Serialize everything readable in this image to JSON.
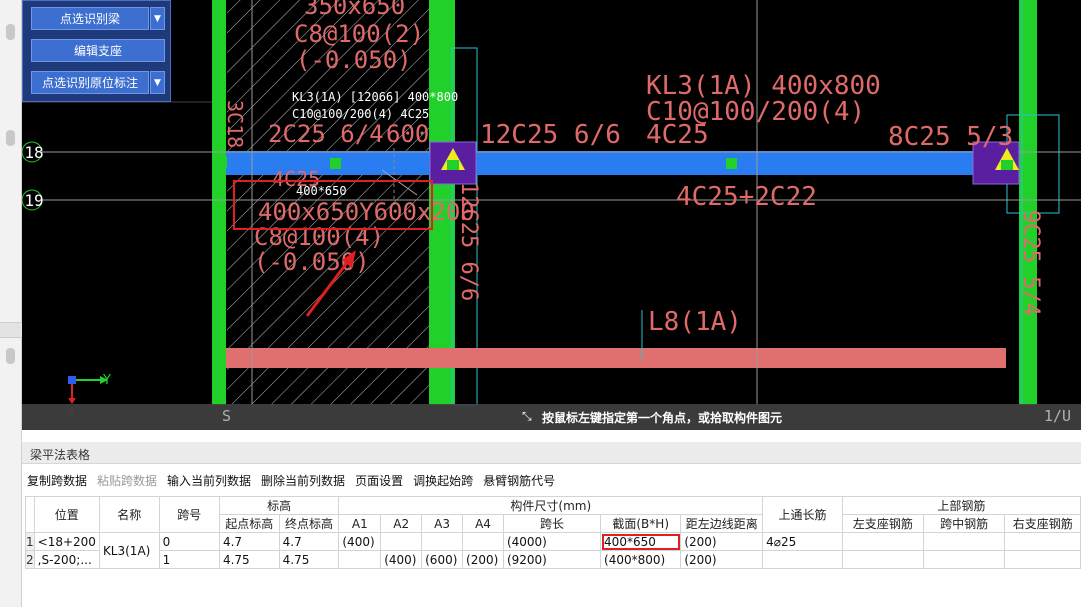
{
  "tool_panel": {
    "btn_identify_beam": "点选识别梁",
    "btn_edit_support": "编辑支座",
    "btn_identify_annotation": "点选识别原位标注"
  },
  "canvas": {
    "axis_labels": [
      "18",
      "19"
    ],
    "ucs_y": "Y",
    "ucs_x": "X",
    "texts": {
      "t_350x650": "350x650",
      "t_c8_100_2": "C8@100(2)",
      "t_m0050_top": "(-0.050)",
      "t_3c18": "3C18",
      "t_kl3_tip": "KL3(1A) [12066] 400*800",
      "t_c10_tip": "C10@100/200(4) 4C25",
      "t_2c25": "2C25 6/4",
      "t_600": "600",
      "t_12c25_66": "12C25 6/6",
      "t_kl3_big": "KL3(1A) 400x800",
      "t_c10_big": "C10@100/200(4)",
      "t_4c25": "4C25",
      "t_8c25": "8C25 5/3",
      "t_400x650_small": "400*650",
      "t_4c25_small": "4C25",
      "t_400x650_big": "400x650Y600x200",
      "t_c8_100_4": "C8@100(4)",
      "t_m0050_bot": "(-0.050)",
      "t_12c25_vert": "12C25 6/6",
      "t_4c25_2c22": "4C25+2C22",
      "t_9c25": "9C25 5/4",
      "t_l8": "L8(1A)"
    },
    "colors": {
      "column_green": "#22d02a",
      "beam_blue": "#2a7df0",
      "beam_red": "#e07070",
      "axis_gray": "#9a9a9a",
      "cad_text": "#e06a6a",
      "highlight_red": "#e02020"
    }
  },
  "status_bar": {
    "prompt": "按鼠标左键指定第一个角点，或拾取构件图元",
    "left_glyph": "S",
    "right_glyph": "1/U"
  },
  "panel": {
    "title": "梁平法表格",
    "toolbar": [
      {
        "label": "复制跨数据",
        "enabled": true
      },
      {
        "label": "粘贴跨数据",
        "enabled": false
      },
      {
        "label": "输入当前列数据",
        "enabled": true
      },
      {
        "label": "删除当前列数据",
        "enabled": true
      },
      {
        "label": "页面设置",
        "enabled": true
      },
      {
        "label": "调换起始跨",
        "enabled": true
      },
      {
        "label": "悬臂钢筋代号",
        "enabled": true
      }
    ]
  },
  "table": {
    "headers": {
      "position": "位置",
      "name": "名称",
      "span_no": "跨号",
      "elevation": "标高",
      "start_elev": "起点标高",
      "end_elev": "终点标高",
      "member_size": "构件尺寸(mm)",
      "a1": "A1",
      "a2": "A2",
      "a3": "A3",
      "a4": "A4",
      "span_len": "跨长",
      "section": "截面(B*H)",
      "edge_dist": "距左边线距离",
      "top_through": "上通长筋",
      "top_rebar": "上部钢筋",
      "left_support": "左支座钢筋",
      "mid_span": "跨中钢筋",
      "right_support": "右支座钢筋"
    },
    "rows": [
      {
        "num": "1",
        "position": "<18+200",
        "name": "KL3(1A)",
        "span": "0",
        "start_elev": "4.7",
        "end_elev": "4.7",
        "a1": "(400)",
        "a2": "",
        "a3": "",
        "a4": "",
        "span_len": "(4000)",
        "section": "400*650",
        "edge_dist": "(200)",
        "top_through": "4⌀25",
        "left_support": "",
        "mid_span": "",
        "right_support": ""
      },
      {
        "num": "2",
        "position": ",S-200;...",
        "name": "",
        "span": "1",
        "start_elev": "4.75",
        "end_elev": "4.75",
        "a1": "",
        "a2": "(400)",
        "a3": "(600)",
        "a4": "(200)",
        "span_len": "(9200)",
        "section": "(400*800)",
        "edge_dist": "(200)",
        "top_through": "",
        "left_support": "",
        "mid_span": "",
        "right_support": ""
      }
    ]
  }
}
